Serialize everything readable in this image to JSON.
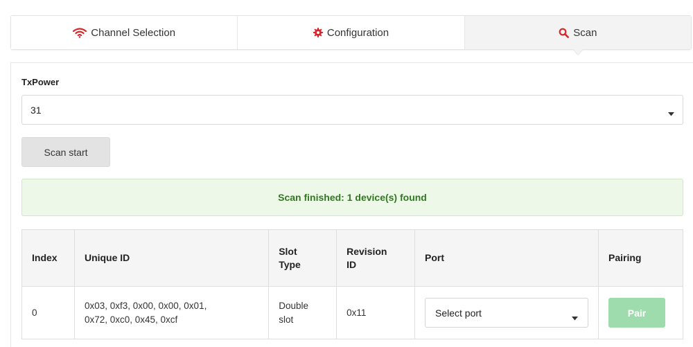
{
  "tabs": [
    {
      "label": "Channel Selection",
      "icon": "wifi-icon",
      "icon_color": "#d9262b",
      "active": false
    },
    {
      "label": "Configuration",
      "icon": "gear-icon",
      "icon_color": "#d9262b",
      "active": false
    },
    {
      "label": "Scan",
      "icon": "search-icon",
      "icon_color": "#d9262b",
      "active": true
    }
  ],
  "txpower": {
    "label": "TxPower",
    "value": "31"
  },
  "scan": {
    "button_label": "Scan start"
  },
  "alert": {
    "message": "Scan finished: 1 device(s) found",
    "color": "#2f7a1f"
  },
  "table": {
    "headers": {
      "index": "Index",
      "unique_id": "Unique ID",
      "slot_type_1": "Slot",
      "slot_type_2": "Type",
      "revision_id_1": "Revision",
      "revision_id_2": "ID",
      "port": "Port",
      "pairing": "Pairing"
    },
    "rows": [
      {
        "index": "0",
        "unique_id_1": "0x03, 0xf3, 0x00, 0x00, 0x01,",
        "unique_id_2": "0x72, 0xc0, 0x45, 0xcf",
        "slot_type_1": "Double",
        "slot_type_2": "slot",
        "revision_id": "0x11",
        "port_placeholder": "Select port",
        "pair_label": "Pair"
      }
    ]
  },
  "colors": {
    "accent_red": "#d9262b",
    "pair_button": "#9fdcad"
  }
}
